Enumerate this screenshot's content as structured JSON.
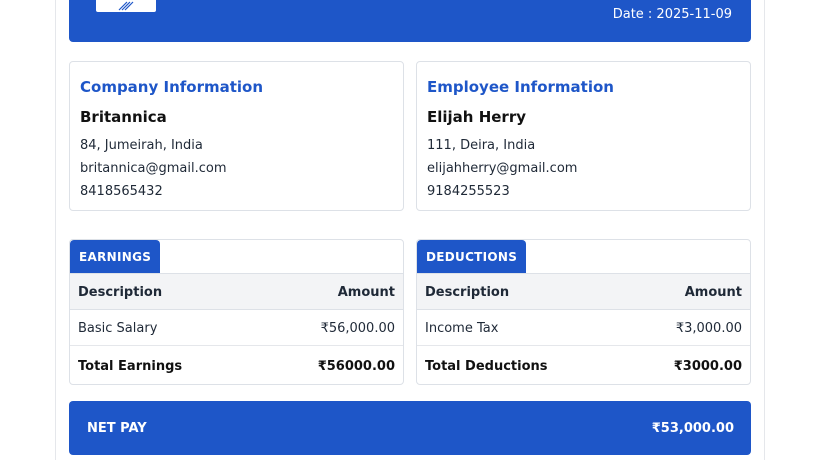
{
  "header": {
    "date_label": "Date : 2025-11-09",
    "logo_icon": "company-logo-icon"
  },
  "company": {
    "section_title": "Company Information",
    "name": "Britannica",
    "address": "84, Jumeirah, India",
    "email": "britannica@gmail.com",
    "phone": "8418565432"
  },
  "employee": {
    "section_title": "Employee Information",
    "name": "Elijah Herry",
    "address": "111, Deira, India",
    "email": "elijahherry@gmail.com",
    "phone": "9184255523"
  },
  "earnings": {
    "tab_label": "EARNINGS",
    "col_description": "Description",
    "col_amount": "Amount",
    "items": [
      {
        "description": "Basic Salary",
        "amount": "₹56,000.00"
      }
    ],
    "total_label": "Total Earnings",
    "total_amount": "₹56000.00"
  },
  "deductions": {
    "tab_label": "DEDUCTIONS",
    "col_description": "Description",
    "col_amount": "Amount",
    "items": [
      {
        "description": "Income Tax",
        "amount": "₹3,000.00"
      }
    ],
    "total_label": "Total Deductions",
    "total_amount": "₹3000.00"
  },
  "net_pay": {
    "label": "NET PAY",
    "amount": "₹53,000.00"
  },
  "colors": {
    "accent": "#1e56c8",
    "border": "#dde1e7",
    "table_header_bg": "#f3f4f6"
  }
}
